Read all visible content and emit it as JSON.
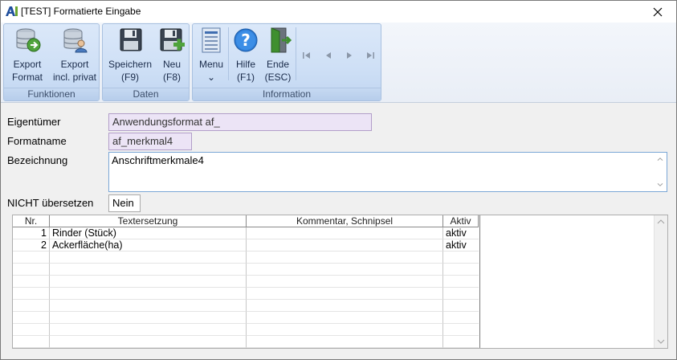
{
  "window": {
    "title": "[TEST] Formatierte Eingabe",
    "logo": "AI"
  },
  "ribbon": {
    "groups": [
      {
        "label": "Funktionen",
        "buttons": [
          {
            "label": "Export\nFormat",
            "icon": "database-export-icon"
          },
          {
            "label": "Export\nincl. privat",
            "icon": "database-export-private-icon"
          }
        ]
      },
      {
        "label": "Daten",
        "buttons": [
          {
            "label": "Speichern\n(F9)",
            "icon": "floppy-save-icon"
          },
          {
            "label": "Neu\n(F8)",
            "icon": "floppy-new-icon"
          }
        ]
      },
      {
        "label": "Information",
        "buttons": [
          {
            "label": "Menu\n⌄",
            "icon": "menu-list-icon"
          },
          {
            "label": "Hilfe\n(F1)",
            "icon": "help-icon"
          },
          {
            "label": "Ende\n(ESC)",
            "icon": "exit-door-icon"
          }
        ]
      }
    ],
    "nav": [
      "first-record-icon",
      "prev-record-icon",
      "next-record-icon",
      "last-record-icon"
    ]
  },
  "form": {
    "eigentuemer_label": "Eigentümer",
    "eigentuemer_value": "Anwendungsformat af_",
    "formatname_label": "Formatname",
    "formatname_value": "af_merkmal4",
    "bezeichnung_label": "Bezeichnung",
    "bezeichnung_value": "Anschriftmerkmale4",
    "nicht_uebersetzen_label": "NICHT übersetzen",
    "nicht_uebersetzen_value": "Nein"
  },
  "grid": {
    "headers": [
      "Nr.",
      "Textersetzung",
      "Kommentar, Schnipsel",
      "Aktiv"
    ],
    "rows": [
      {
        "nr": "1",
        "text": "Rinder (Stück)",
        "kommentar": "",
        "aktiv": "aktiv"
      },
      {
        "nr": "2",
        "text": "Ackerfläche(ha)",
        "kommentar": "",
        "aktiv": "aktiv"
      }
    ]
  },
  "colors": {
    "ribbon_group": "#cfe0f6",
    "readonly_field": "#ece4f6",
    "logo_blue": "#1f4e9c",
    "logo_green": "#6aa531"
  }
}
